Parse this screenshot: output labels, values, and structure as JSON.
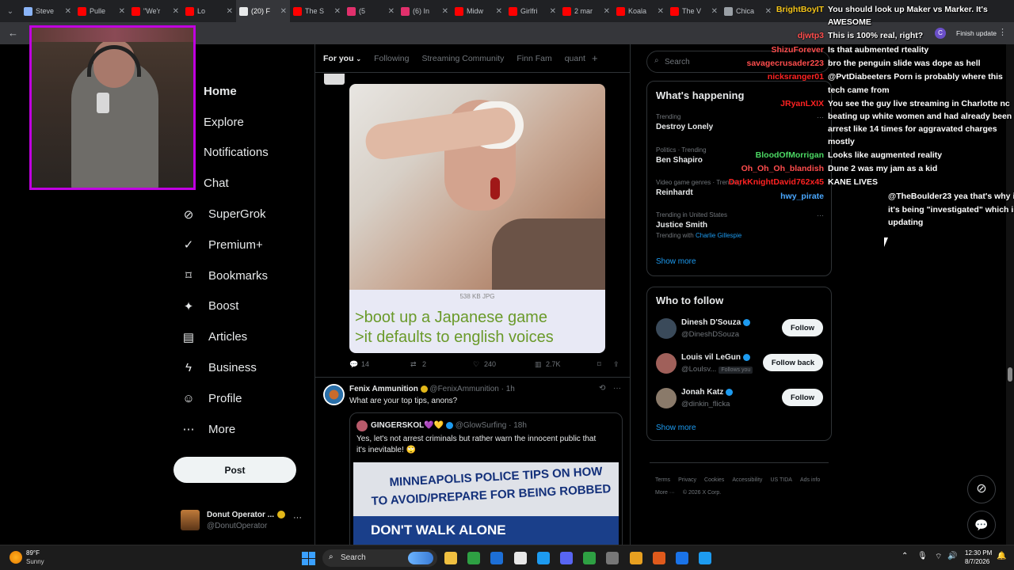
{
  "browser": {
    "tabs": [
      {
        "label": "Steve",
        "color": "#8ab4f8"
      },
      {
        "label": "Pulle",
        "color": "#ff0000"
      },
      {
        "label": "\"We'r",
        "color": "#ff0000"
      },
      {
        "label": "Lo",
        "color": "#ff0000"
      },
      {
        "label": "(20) F",
        "color": "#e7e9ea"
      },
      {
        "label": "The S",
        "color": "#ff0000"
      },
      {
        "label": "(5",
        "color": "#e1306c"
      },
      {
        "label": "(6) In",
        "color": "#e1306c"
      },
      {
        "label": "Midw",
        "color": "#ff0000"
      },
      {
        "label": "Girlfri",
        "color": "#ff0000"
      },
      {
        "label": "2 mar",
        "color": "#ff0000"
      },
      {
        "label": "Koala",
        "color": "#ff0000"
      },
      {
        "label": "The V",
        "color": "#ff0000"
      },
      {
        "label": "Chica",
        "color": "#9aa0a6"
      }
    ],
    "update_label": "Finish update",
    "profile_initial": "C"
  },
  "left_nav": {
    "items": [
      {
        "label": "Home",
        "icon": "home-icon"
      },
      {
        "label": "Explore",
        "icon": "search-icon"
      },
      {
        "label": "Notifications",
        "icon": "bell-icon"
      },
      {
        "label": "Chat",
        "icon": "mail-icon"
      },
      {
        "label": "SuperGrok",
        "icon": "grok-icon"
      },
      {
        "label": "Premium+",
        "icon": "verified-icon"
      },
      {
        "label": "Bookmarks",
        "icon": "bookmark-icon"
      },
      {
        "label": "Boost",
        "icon": "boost-icon"
      },
      {
        "label": "Articles",
        "icon": "article-icon"
      },
      {
        "label": "Business",
        "icon": "lightning-icon"
      },
      {
        "label": "Profile",
        "icon": "person-icon"
      },
      {
        "label": "More",
        "icon": "more-icon"
      }
    ],
    "post_label": "Post",
    "account_name": "Donut Operator ...",
    "account_handle": "@DonutOperator"
  },
  "feed": {
    "tabs": [
      "For you",
      "Following",
      "Streaming Community",
      "Finn Fam",
      "quant"
    ],
    "post1": {
      "file_info": "538 KB JPG",
      "green_line1": ">boot up a Japanese game",
      "green_line2": ">it defaults to english voices",
      "replies": "14",
      "reposts": "2",
      "likes": "240",
      "views": "2.7K"
    },
    "post2": {
      "name": "Fenix Ammunition",
      "handle": "@FenixAmmunition",
      "time": "· 1h",
      "text": "What are your top tips, anons?",
      "quote_name": "GINGERSKOL💜💛",
      "quote_handle": "@GlowSurfing",
      "quote_time": "· 18h",
      "quote_text1": "Yes, let's not arrest criminals but rather warn the innocent public that",
      "quote_text2": "it's inevitable! 🙄",
      "sign_line1": "MINNEAPOLIS POLICE TIPS ON HOW",
      "sign_line2": "TO AVOID/PREPARE FOR BEING ROBBED",
      "sign_line3": "DON'T WALK ALONE"
    }
  },
  "sidebar": {
    "search_placeholder": "Search",
    "happening_title": "What's happening",
    "trends": [
      {
        "context": "Trending",
        "name": "Destroy Lonely",
        "extra": ""
      },
      {
        "context": "Politics · Trending",
        "name": "Ben Shapiro",
        "extra": ""
      },
      {
        "context": "Video game genres · Trending",
        "name": "Reinhardt",
        "extra": ""
      },
      {
        "context": "Trending in United States",
        "name": "Justice Smith",
        "extra": "Trending with",
        "extra_link": "Charlie Gillespie"
      }
    ],
    "show_more": "Show more",
    "follow_title": "Who to follow",
    "follow": [
      {
        "name": "Dinesh D'Souza",
        "handle": "@DineshDSouza",
        "button": "Follow",
        "badge": ""
      },
      {
        "name": "Louis vil LeGun",
        "handle": "@Loulsv...",
        "button": "Follow back",
        "badge": "Follows you"
      },
      {
        "name": "Jonah Katz",
        "handle": "@dinkin_flicka",
        "button": "Follow",
        "badge": ""
      }
    ],
    "show_more_2": "Show more",
    "footer": [
      "Terms",
      "Privacy",
      "Cookies",
      "Accessibility",
      "US TIDA",
      "Ads info",
      "More ···",
      "© 2026 X Corp."
    ]
  },
  "chat": [
    {
      "user": "BrightBoyIT",
      "color": "#f5c518",
      "text": "You should look up Maker vs Marker. It's"
    },
    {
      "user": "",
      "color": "",
      "text": "AWESOME"
    },
    {
      "user": "djwtp3",
      "color": "#ff4d4d",
      "text": "This is 100% real, right?"
    },
    {
      "user": "ShizuForever",
      "color": "#ff4d4d",
      "text": "Is that aubmented rteality"
    },
    {
      "user": "savagecrusader223",
      "color": "#ff4d4d",
      "text": "bro the penguin slide was dope as hell"
    },
    {
      "user": "nicksranger01",
      "color": "#ff2222",
      "text": "@PvtDiabeeters Porn is probably where this"
    },
    {
      "user": "",
      "color": "",
      "text": "tech came from"
    },
    {
      "user": "JRyanLXIX",
      "color": "#ff2222",
      "text": "You see the guy live streaming in Charlotte nc"
    },
    {
      "user": "",
      "color": "",
      "text": "beating up white women and had already been"
    },
    {
      "user": "",
      "color": "",
      "text": "arrest like 14 times for aggravated charges"
    },
    {
      "user": "",
      "color": "",
      "text": "mostly"
    },
    {
      "user": "BloodOfMorrigan",
      "color": "#4cd964",
      "text": "Looks like augmented reality"
    },
    {
      "user": "Oh_Oh_Oh_blandish",
      "color": "#ff4d4d",
      "text": "Dune 2 was my jam as a kid"
    },
    {
      "user": "DarkKnightDavid762x45",
      "color": "#ff2222",
      "text": "KANE LIVES"
    },
    {
      "user": "hwy_pirate",
      "color": "#4aa8ff",
      "text": "@TheBoulder23 yea that's why i"
    },
    {
      "user": "",
      "color": "",
      "text": "it's being \"investigated\" which is"
    },
    {
      "user": "",
      "color": "",
      "text": "updating"
    }
  ],
  "taskbar": {
    "weather_temp": "89°F",
    "weather_desc": "Sunny",
    "search_label": "Search",
    "time": "12:30 PM",
    "date": "8/7/2026"
  }
}
